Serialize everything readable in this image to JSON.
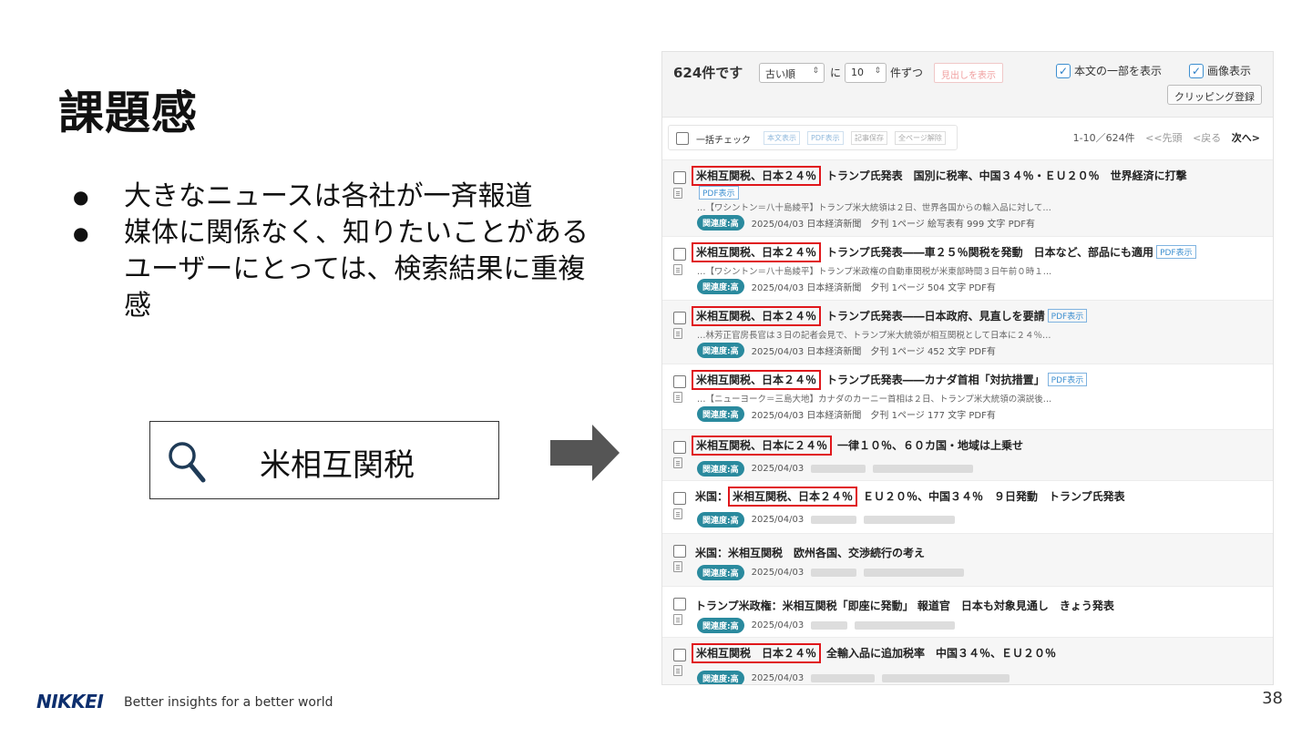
{
  "slide": {
    "title": "課題感",
    "bullets": [
      "大きなニュースは各社が一斉報道",
      "媒体に関係なく、知りたいことがあるユーザーにとっては、検索結果に重複感"
    ],
    "search_term": "米相互関税",
    "page_number": "38"
  },
  "footer": {
    "brand": "NIKKEI",
    "tagline": "Better insights for a better world"
  },
  "panel": {
    "count_label": "624件です",
    "sort_select": "古い順",
    "per_page_prefix": "に",
    "per_page_select": "10",
    "per_page_suffix": "件ずつ",
    "headline_only_button": "見出しを表示",
    "show_body_label": "本文の一部を表示",
    "show_image_label": "画像表示",
    "clipping_button": "クリッピング登録",
    "bulk_check_label": "一括チェック",
    "bulk_buttons": [
      "本文表示",
      "PDF表示",
      "記事保存",
      "全ページ解除"
    ],
    "pager": {
      "range": "1-10／624件",
      "first": "<<先頭",
      "prev": "<戻る",
      "next": "次へ>"
    },
    "pdf_label": "PDF表示",
    "relevance_badge": "関連度:高",
    "results": [
      {
        "highlight": "米相互関税、日本２４％",
        "title": "トランプ氏発表　国別に税率、中国３４％・ＥＵ２０％　世界経済に打撃",
        "snippet": "…【ワシントン＝八十島綾平】トランプ米大統領は２日、世界各国からの輸入品に対して…",
        "meta": "2025/04/03  日本経済新聞　夕刊  1ページ  絵写表有  999 文字  PDF有"
      },
      {
        "highlight": "米相互関税、日本２４％",
        "title": "トランプ氏発表――車２５％関税を発動　日本など、部品にも適用",
        "snippet": "…【ワシントン＝八十島綾平】トランプ米政権の自動車関税が米東部時間３日午前０時１…",
        "meta": "2025/04/03  日本経済新聞　夕刊  1ページ  504 文字  PDF有"
      },
      {
        "highlight": "米相互関税、日本２４％",
        "title": "トランプ氏発表――日本政府、見直しを要請",
        "snippet": "…林芳正官房長官は３日の記者会見で、トランプ米大統領が相互関税として日本に２４％…",
        "meta": "2025/04/03  日本経済新聞　夕刊  1ページ  452 文字  PDF有"
      },
      {
        "highlight": "米相互関税、日本２４％",
        "title": "トランプ氏発表――カナダ首相「対抗措置」",
        "snippet": "…【ニューヨーク＝三島大地】カナダのカーニー首相は２日、トランプ米大統領の演説後…",
        "meta": "2025/04/03  日本経済新聞　夕刊  1ページ  177 文字  PDF有"
      },
      {
        "highlight": "米相互関税、日本に２４％",
        "title": "一律１０％、６０カ国・地域は上乗せ",
        "date": "2025/04/03"
      },
      {
        "prefix": "米国：",
        "highlight": "米相互関税、日本２４％",
        "title": "ＥＵ２０％、中国３４％　９日発動　トランプ氏発表",
        "date": "2025/04/03"
      },
      {
        "title": "米国：米相互関税　欧州各国、交渉続行の考え",
        "date": "2025/04/03"
      },
      {
        "title": "トランプ米政権：米相互関税「即座に発動」 報道官　日本も対象見通し　きょう発表",
        "date": "2025/04/03"
      },
      {
        "highlight": "米相互関税　日本２４％",
        "title": "全輸入品に追加税率　中国３４％、ＥＵ２０％",
        "date": "2025/04/03"
      }
    ]
  },
  "colors": {
    "highlight_border": "#e0161b",
    "badge": "#2a8a9e",
    "brand": "#0d2f6e",
    "arrow": "#555555"
  }
}
